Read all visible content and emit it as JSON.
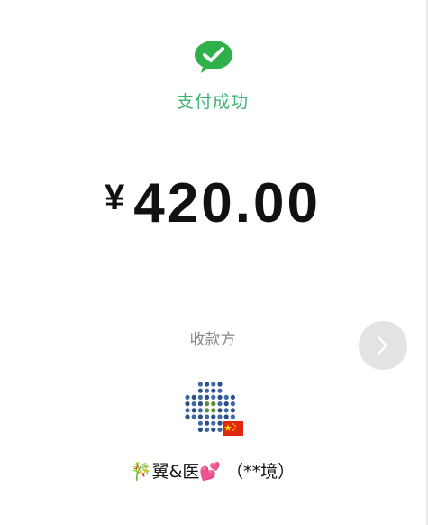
{
  "payment": {
    "status_text": "支付成功",
    "currency_symbol": "¥",
    "amount": "420.00"
  },
  "payee": {
    "label": "收款方",
    "name": "🎋翼&医💕 （**境）",
    "flag": "cn-flag-icon"
  },
  "icons": {
    "success": "wechat-check-icon",
    "next": "chevron-right-icon"
  },
  "colors": {
    "accent_green": "#3cb371",
    "text_dark": "#111111",
    "text_gray": "#888888",
    "button_gray": "#e3e3e3"
  }
}
